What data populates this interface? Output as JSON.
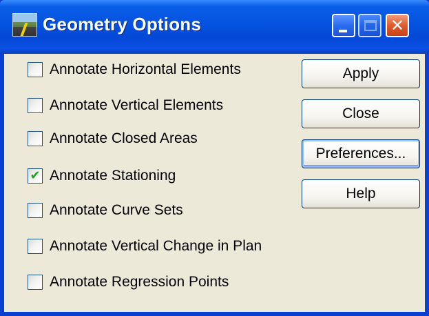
{
  "window": {
    "title": "Geometry Options"
  },
  "checkboxes": [
    {
      "label": "Annotate Horizontal Elements",
      "checked": false
    },
    {
      "label": "Annotate Vertical Elements",
      "checked": false
    },
    {
      "label": "Annotate Closed Areas",
      "checked": false
    },
    {
      "label": "Annotate Stationing",
      "checked": true
    },
    {
      "label": "Annotate Curve Sets",
      "checked": false
    },
    {
      "label": "Annotate Vertical Change in Plan",
      "checked": false
    },
    {
      "label": "Annotate Regression Points",
      "checked": false
    }
  ],
  "buttons": {
    "apply": "Apply",
    "close": "Close",
    "preferences": "Preferences...",
    "help": "Help"
  },
  "colors": {
    "titlebar": "#0552e0",
    "dialog_face": "#ece9d8",
    "checkmark": "#21a121"
  }
}
